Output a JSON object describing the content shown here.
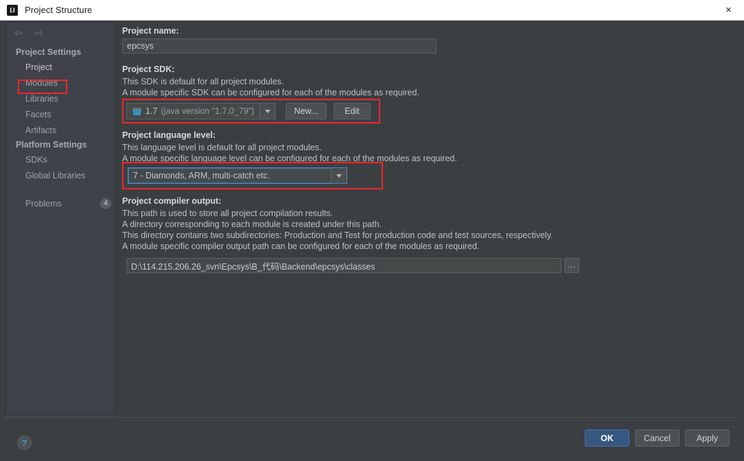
{
  "window": {
    "title": "Project Structure",
    "app_icon": "intellij-idea-icon",
    "close_icon": "×"
  },
  "sidebar": {
    "nav_back_icon": "⇦",
    "nav_forward_icon": "⇨",
    "groups": [
      {
        "header": "Project Settings",
        "items": [
          {
            "label": "Project",
            "selected": true
          },
          {
            "label": "Modules",
            "selected": false
          },
          {
            "label": "Libraries",
            "selected": false
          },
          {
            "label": "Facets",
            "selected": false
          },
          {
            "label": "Artifacts",
            "selected": false
          }
        ]
      },
      {
        "header": "Platform Settings",
        "items": [
          {
            "label": "SDKs",
            "selected": false
          },
          {
            "label": "Global Libraries",
            "selected": false
          }
        ]
      }
    ],
    "problems": {
      "label": "Problems",
      "count": "4"
    }
  },
  "main": {
    "project_name": {
      "label": "Project name:",
      "value": "epcsys"
    },
    "project_sdk": {
      "label": "Project SDK:",
      "desc_line1": "This SDK is default for all project modules.",
      "desc_line2": "A module specific SDK can be configured for each of the modules as required.",
      "selected_version": "1.7",
      "selected_detail": "(java version \"1.7.0_79\")",
      "new_button": "New...",
      "new_button_mnemonic": "N",
      "edit_button": "Edit",
      "edit_button_mnemonic": "E"
    },
    "project_language_level": {
      "label": "Project language level:",
      "desc_line1": "This language level is default for all project modules.",
      "desc_line2": "A module specific language level can be configured for each of the modules as required.",
      "selected": "7 - Diamonds, ARM, multi-catch etc."
    },
    "project_compiler_output": {
      "label": "Project compiler output:",
      "desc_line1": "This path is used to store all project compilation results.",
      "desc_line2": "A directory corresponding to each module is created under this path.",
      "desc_line3": "This directory contains two subdirectories: Production and Test for production code and test sources, respectively.",
      "desc_line4": "A module specific compiler output path can be configured for each of the modules as required.",
      "value": "D:\\114.215.206.26_svn\\Epcsys\\B_代码\\Backend\\epcsys\\classes",
      "browse_label": "..."
    }
  },
  "footer": {
    "help_label": "?",
    "ok_label": "OK",
    "cancel_label": "Cancel",
    "apply_label": "Apply",
    "apply_mnemonic": "A"
  },
  "annotations": {
    "accent_color": "#f4262c",
    "boxes": [
      "project-nav-item",
      "project-sdk-row",
      "project-language-level-combo"
    ]
  }
}
